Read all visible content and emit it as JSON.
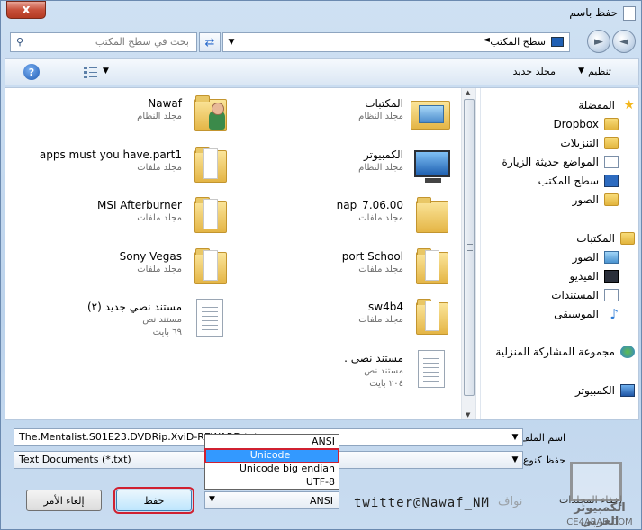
{
  "window": {
    "title": "حفظ باسم",
    "close_label": "x"
  },
  "nav": {
    "address_text": "سطح المكتب",
    "address_arrow": "◄",
    "search_placeholder": "بحث في سطح المكتب"
  },
  "toolbar": {
    "organize_label": "تنظيم",
    "new_folder_label": "مجلد جديد"
  },
  "sidebar": {
    "items": [
      {
        "label": "المفضلة",
        "icon": "star-icon"
      },
      {
        "label": "Dropbox",
        "icon": "folder-icon"
      },
      {
        "label": "التنزيلات",
        "icon": "folder-icon"
      },
      {
        "label": "المواضع حديثة الزيارة",
        "icon": "recent-places-icon"
      },
      {
        "label": "سطح المكتب",
        "icon": "desktop-icon"
      },
      {
        "label": "الصور",
        "icon": "folder-icon"
      },
      {
        "label": "المكتبات",
        "icon": "libraries-icon"
      },
      {
        "label": "الصور",
        "icon": "pictures-icon"
      },
      {
        "label": "الفيديو",
        "icon": "video-icon"
      },
      {
        "label": "المستندات",
        "icon": "documents-icon"
      },
      {
        "label": "الموسيقى",
        "icon": "music-icon"
      },
      {
        "label": "مجموعة المشاركة المنزلية",
        "icon": "homegroup-icon"
      },
      {
        "label": "الكمبيوتر",
        "icon": "computer-icon"
      }
    ]
  },
  "files": [
    {
      "name": "المكتبات",
      "type": "مجلد النظام",
      "size": "",
      "icon": "libraries-folder-icon"
    },
    {
      "name": "Nawaf",
      "type": "مجلد النظام",
      "size": "",
      "icon": "user-folder-icon"
    },
    {
      "name": "الكمبيوتر",
      "type": "مجلد النظام",
      "size": "",
      "icon": "computer-icon"
    },
    {
      "name": "apps must you have.part1",
      "type": "مجلد ملفات",
      "size": "",
      "icon": "folder-icon"
    },
    {
      "name": "nap_7.06.00",
      "type": "مجلد ملفات",
      "size": "",
      "icon": "folder-icon"
    },
    {
      "name": "MSI Afterburner",
      "type": "مجلد ملفات",
      "size": "",
      "icon": "folder-icon"
    },
    {
      "name": "port School",
      "type": "مجلد ملفات",
      "size": "",
      "icon": "folder-icon"
    },
    {
      "name": "Sony Vegas",
      "type": "مجلد ملفات",
      "size": "",
      "icon": "folder-icon"
    },
    {
      "name": "sw4b4",
      "type": "مجلد ملفات",
      "size": "",
      "icon": "folder-icon"
    },
    {
      "name": "مستند نصي جديد (٢)",
      "type": "مستند نص",
      "size": "٦٩ بايت",
      "icon": "text-document-icon"
    },
    {
      "name": "مستند نصي .",
      "type": "مستند نص",
      "size": "٢٠٤ بايت",
      "icon": "text-document-icon"
    }
  ],
  "form": {
    "filename_label": "اسم الملف:",
    "filename_value": "The.Mentalist.S01E23.DVDRip.XviD-REWARD.txt",
    "savetype_label": "حفظ كنوع:",
    "savetype_value": "Text Documents (*.txt)",
    "encoding_options": [
      "ANSI",
      "Unicode",
      "Unicode big endian",
      "UTF-8"
    ],
    "encoding_selected_option": "Unicode",
    "encoding_value": "ANSI",
    "save_label": "حفظ",
    "cancel_label": "إلغاء الأمر",
    "hide_folders_label": "إخفاء المجلدات"
  },
  "watermark": {
    "twitter": "twitter@Nawaf_NM",
    "arabic_name": "نواف",
    "logo_ar": "الكمبيوتر العربي",
    "logo_en": "CE4ARAB.COM"
  },
  "colors": {
    "accent": "#3399ff",
    "highlight_border": "#d02030",
    "close": "#c7503a"
  }
}
